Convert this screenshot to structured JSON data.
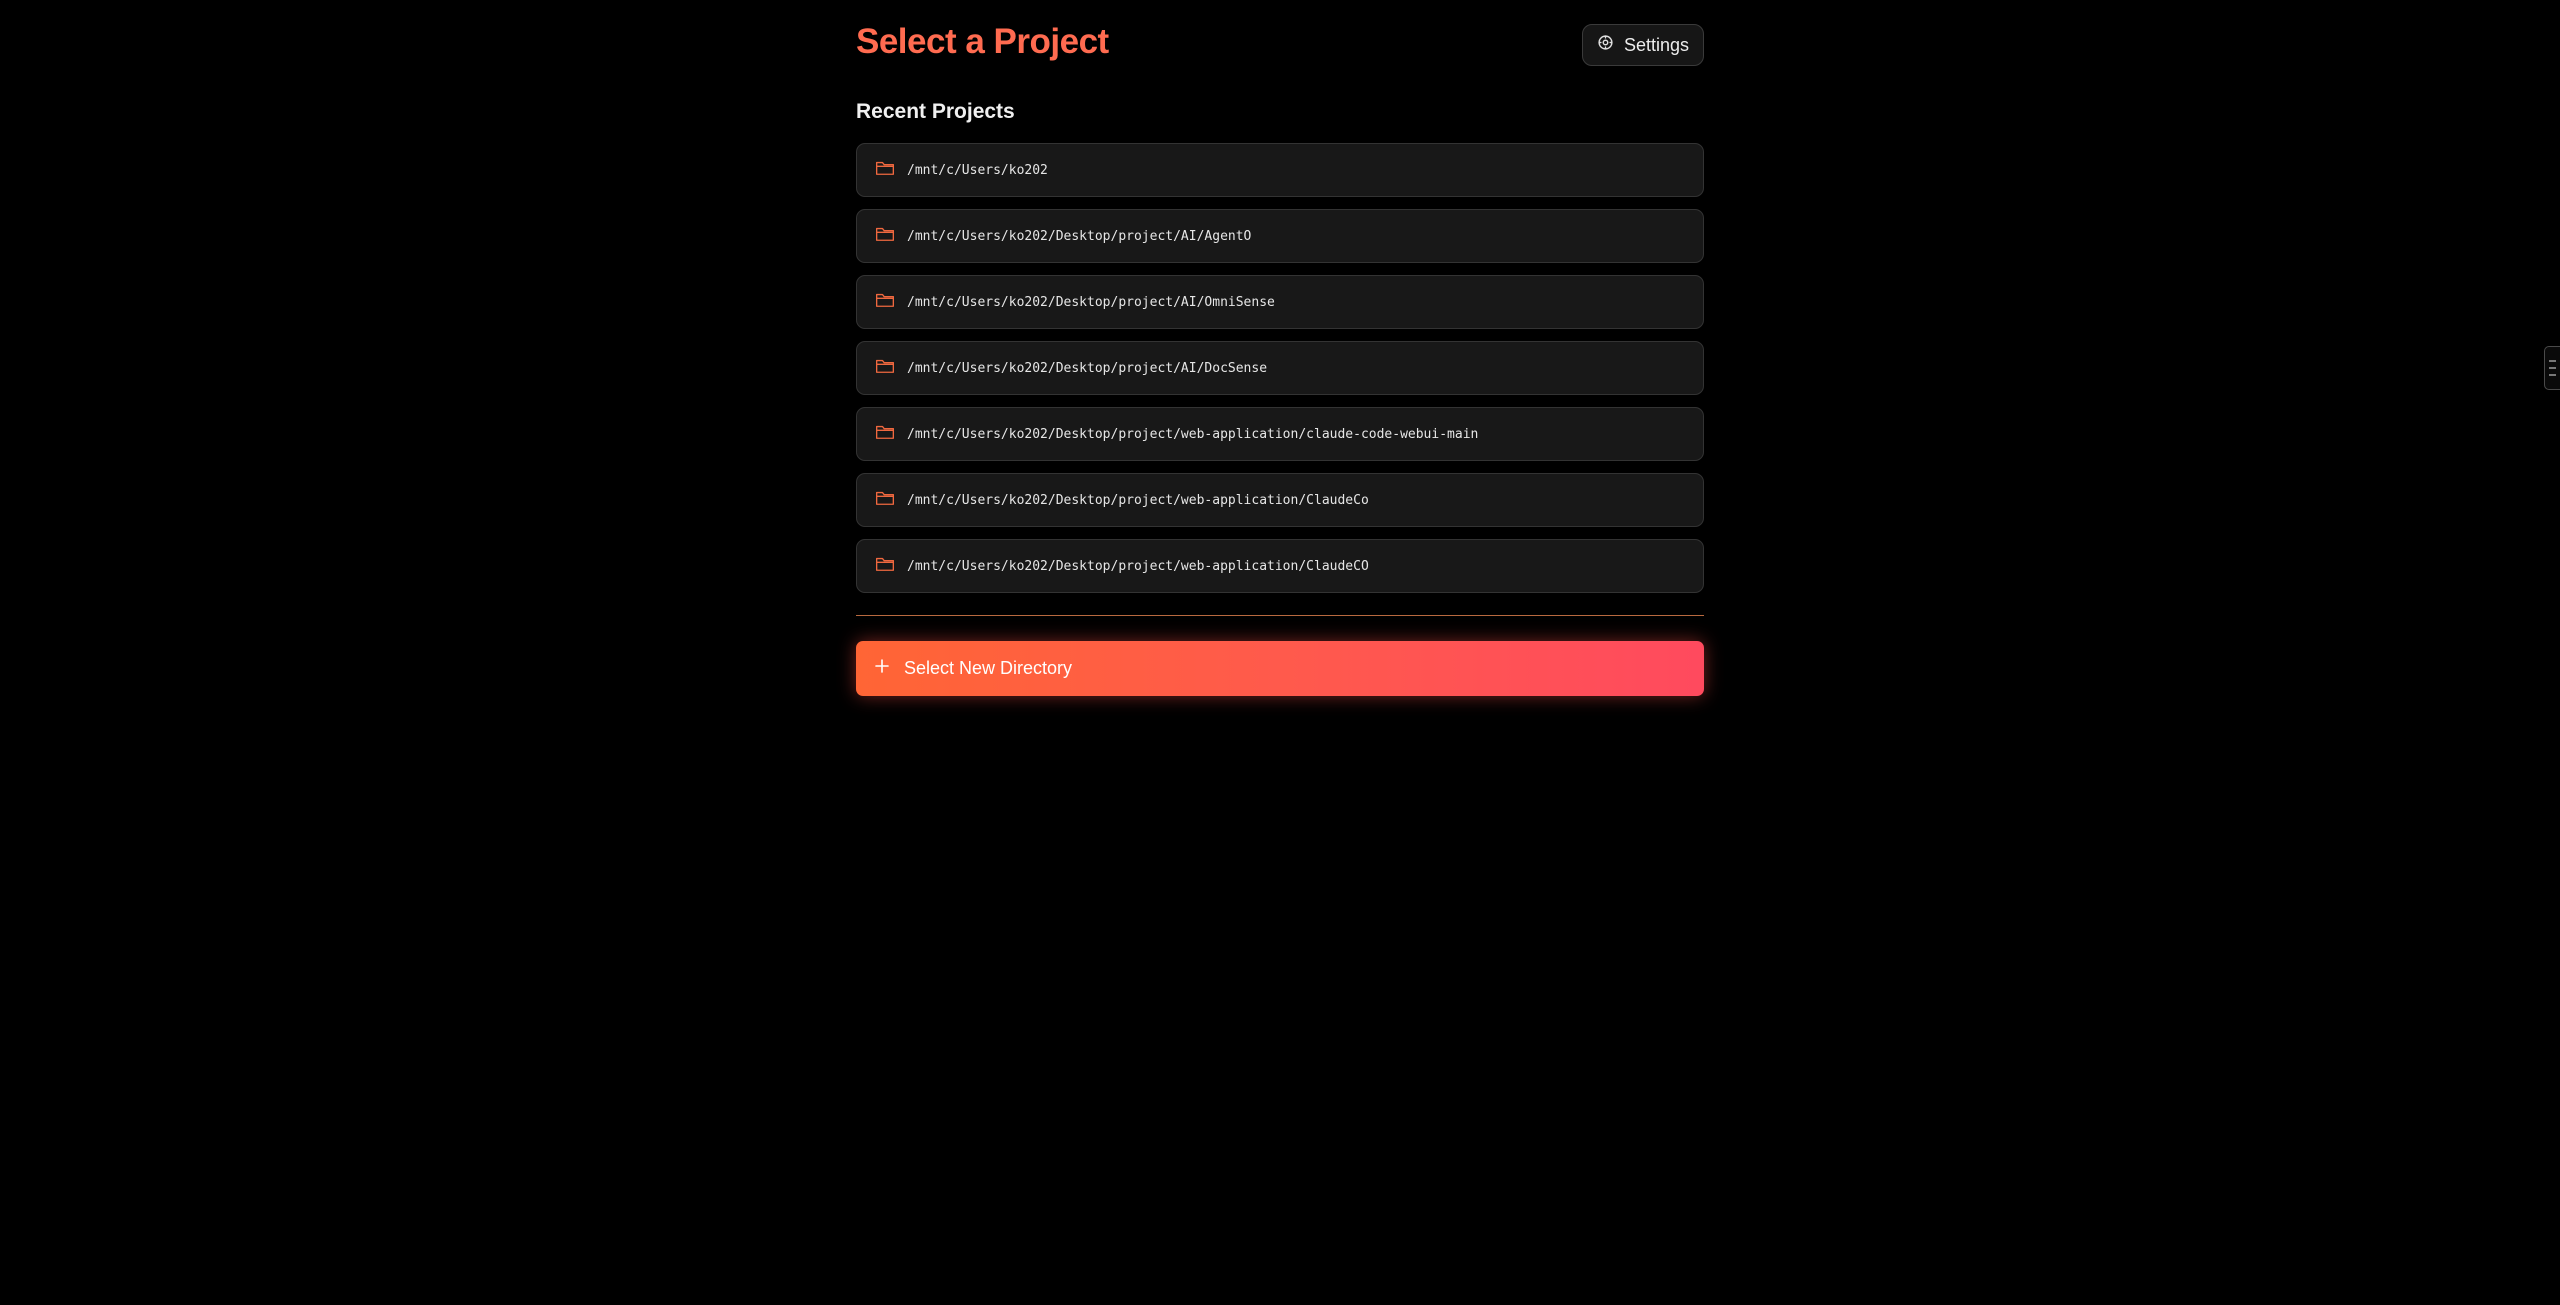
{
  "header": {
    "title": "Select a Project",
    "settings_label": "Settings",
    "settings_icon": "gear-icon"
  },
  "recent": {
    "title": "Recent Projects",
    "folder_icon": "folder-icon",
    "items": [
      {
        "path": "/mnt/c/Users/ko202"
      },
      {
        "path": "/mnt/c/Users/ko202/Desktop/project/AI/AgentO"
      },
      {
        "path": "/mnt/c/Users/ko202/Desktop/project/AI/OmniSense"
      },
      {
        "path": "/mnt/c/Users/ko202/Desktop/project/AI/DocSense"
      },
      {
        "path": "/mnt/c/Users/ko202/Desktop/project/web-application/claude-code-webui-main"
      },
      {
        "path": "/mnt/c/Users/ko202/Desktop/project/web-application/ClaudeCo"
      },
      {
        "path": "/mnt/c/Users/ko202/Desktop/project/web-application/ClaudeCO"
      }
    ]
  },
  "actions": {
    "select_new_label": "Select New Directory",
    "select_new_icon": "plus-icon"
  },
  "colors": {
    "background": "#000000",
    "accent": "#ff6b50",
    "gradient_start": "#ff6535",
    "gradient_end": "#ff4a5e",
    "card_bg": "#181818",
    "card_border": "#333333"
  }
}
